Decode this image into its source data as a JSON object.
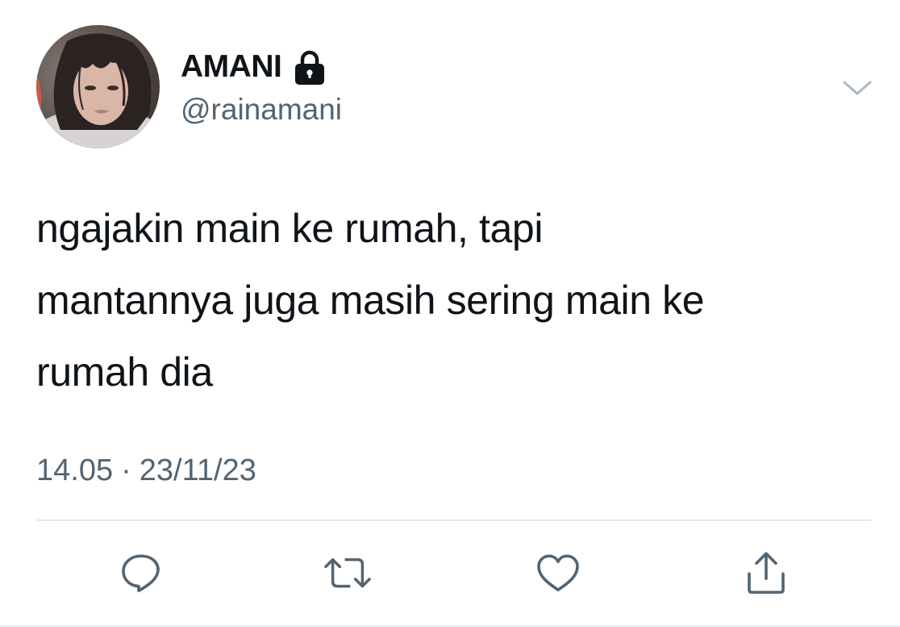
{
  "tweet": {
    "author": {
      "display_name": "AMANI",
      "handle": "@rainamani",
      "protected_icon": "lock-icon",
      "avatar_icon": "profile-photo"
    },
    "text_lines": [
      "ngajakin main ke rumah, tapi",
      "mantannya juga masih sering main ke",
      "rumah dia"
    ],
    "time": "14.05",
    "separator": "·",
    "date": "23/11/23"
  },
  "actions": [
    {
      "name": "reply",
      "icon": "reply-icon"
    },
    {
      "name": "retweet",
      "icon": "retweet-icon"
    },
    {
      "name": "like",
      "icon": "heart-icon"
    },
    {
      "name": "share",
      "icon": "share-icon"
    }
  ],
  "menu": {
    "icon": "chevron-down-icon"
  },
  "colors": {
    "text": "#0f1419",
    "secondary": "#536471",
    "icon": "#536471",
    "divider": "#cfd9de",
    "background": "#ffffff"
  }
}
